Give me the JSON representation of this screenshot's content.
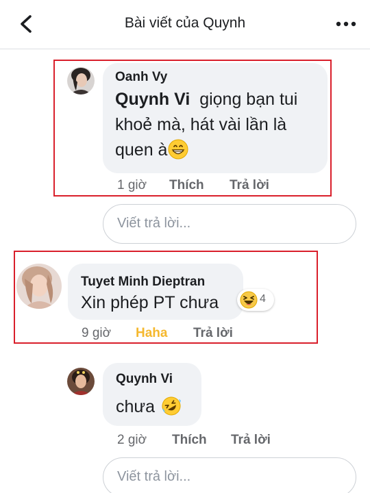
{
  "header": {
    "title": "Bài viết của Quynh"
  },
  "comments": [
    {
      "author": "Oanh Vy",
      "mention": "Quynh Vi",
      "line1_rest": "giọng bạn tui",
      "line2": "khoẻ mà, hát vài lần là",
      "line3": "quen à",
      "emoji": "grinning-face",
      "time": "1 giờ",
      "like_label": "Thích",
      "reply_label": "Trả lời"
    },
    {
      "author": "Tuyet Minh Dieptran",
      "text": "Xin phép PT chưa",
      "reaction": "haha",
      "reaction_count": "4",
      "time": "9 giờ",
      "reaction_label": "Haha",
      "reply_label": "Trả lời"
    },
    {
      "author": "Quynh Vi",
      "text": "chưa",
      "emoji": "rolling-on-floor-laughing",
      "time": "2 giờ",
      "like_label": "Thích",
      "reply_label": "Trả lời"
    }
  ],
  "reply_inputs": [
    {
      "placeholder": "Viết trả lời..."
    },
    {
      "placeholder": "Viết trả lời..."
    }
  ],
  "colors": {
    "highlight_border": "#d91e2a",
    "bubble_bg": "#f0f2f5",
    "meta_text": "#65676b",
    "haha_active": "#f5b82e"
  }
}
